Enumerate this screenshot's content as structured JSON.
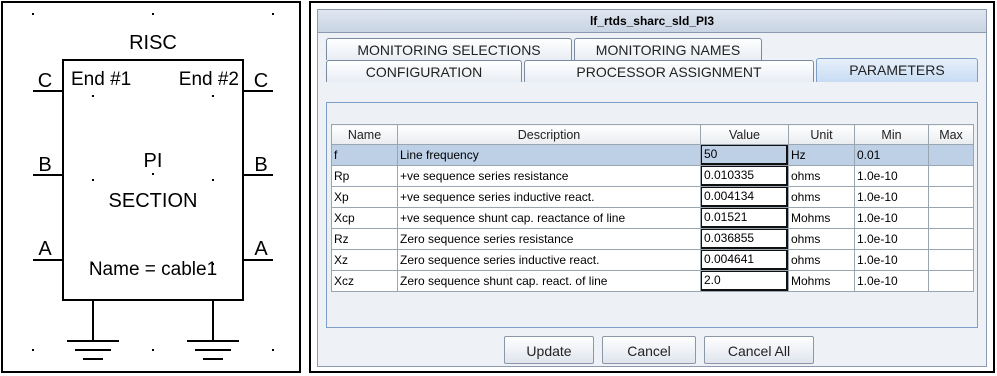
{
  "schematic": {
    "header": "RISC",
    "end1": "End #1",
    "end2": "End #2",
    "pi": "PI",
    "section": "SECTION",
    "name": "Name = cable1",
    "port_c_left": "C",
    "port_c_right": "C",
    "port_b_left": "B",
    "port_b_right": "B",
    "port_a_left": "A",
    "port_a_right": "A"
  },
  "dialog": {
    "title": "lf_rtds_sharc_sld_PI3",
    "tabs_row1": [
      {
        "label": "MONITORING SELECTIONS"
      },
      {
        "label": "MONITORING NAMES"
      }
    ],
    "tabs_row2": [
      {
        "label": "CONFIGURATION"
      },
      {
        "label": "PROCESSOR ASSIGNMENT"
      },
      {
        "label": "PARAMETERS",
        "active": true
      }
    ],
    "columns": [
      "Name",
      "Description",
      "Value",
      "Unit",
      "Min",
      "Max"
    ],
    "rows": [
      {
        "name": "f",
        "description": "Line frequency",
        "value": "50",
        "unit": "Hz",
        "min": "0.01",
        "max": ""
      },
      {
        "name": "Rp",
        "description": "+ve sequence series resistance",
        "value": "0.010335",
        "unit": "ohms",
        "min": "1.0e-10",
        "max": ""
      },
      {
        "name": "Xp",
        "description": "+ve sequence series inductive react.",
        "value": "0.004134",
        "unit": "ohms",
        "min": "1.0e-10",
        "max": ""
      },
      {
        "name": "Xcp",
        "description": "+ve sequence shunt cap. reactance of line",
        "value": "0.01521",
        "unit": "Mohms",
        "min": "1.0e-10",
        "max": ""
      },
      {
        "name": "Rz",
        "description": "Zero sequence series resistance",
        "value": "0.036855",
        "unit": "ohms",
        "min": "1.0e-10",
        "max": ""
      },
      {
        "name": "Xz",
        "description": "Zero sequence series inductive react.",
        "value": "0.004641",
        "unit": "ohms",
        "min": "1.0e-10",
        "max": ""
      },
      {
        "name": "Xcz",
        "description": "Zero sequence shunt cap. react. of line",
        "value": "2.0",
        "unit": "Mohms",
        "min": "1.0e-10",
        "max": ""
      }
    ],
    "buttons": {
      "update": "Update",
      "cancel": "Cancel",
      "cancel_all": "Cancel All"
    }
  }
}
